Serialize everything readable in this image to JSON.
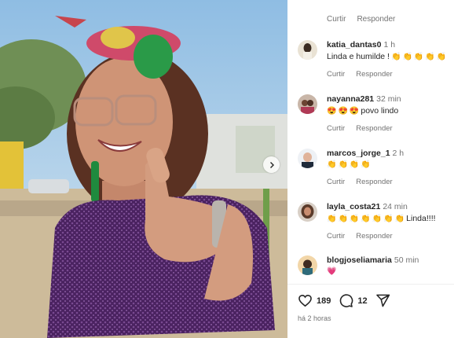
{
  "post": {
    "image_alt": "Woman in purple sequin dress smiling with thumbs up"
  },
  "top_actions": {
    "like": "Curtir",
    "reply": "Responder"
  },
  "comments": [
    {
      "username": "katia_dantas0",
      "time": "1 h",
      "text": "Linda e humilde !",
      "emojis": [
        "clap",
        "clap",
        "clap",
        "clap",
        "clap"
      ],
      "like": "Curtir",
      "reply": "Responder"
    },
    {
      "username": "nayanna281",
      "time": "32 min",
      "text": "povo lindo",
      "emojis_before": [
        "heart-eyes",
        "heart-eyes",
        "heart-eyes"
      ],
      "like": "Curtir",
      "reply": "Responder"
    },
    {
      "username": "marcos_jorge_1",
      "time": "2 h",
      "text": "",
      "emojis": [
        "clap",
        "clap",
        "clap",
        "clap"
      ],
      "like": "Curtir",
      "reply": "Responder"
    },
    {
      "username": "layla_costa21",
      "time": "24 min",
      "text": "Linda!!!!",
      "emojis_before": [
        "clap",
        "clap",
        "clap",
        "clap",
        "clap",
        "clap",
        "clap"
      ],
      "like": "Curtir",
      "reply": "Responder"
    },
    {
      "username": "blogjoseliamaria",
      "time": "50 min",
      "text": "",
      "emojis": [
        "pink-heart"
      ]
    }
  ],
  "stats": {
    "likes": "189",
    "comments": "12"
  },
  "posted_ago": "há 2 horas",
  "colors": {
    "text": "#262626",
    "muted": "#737373",
    "sequin": "#5b2a6e",
    "sky": "#a9cbe6"
  }
}
